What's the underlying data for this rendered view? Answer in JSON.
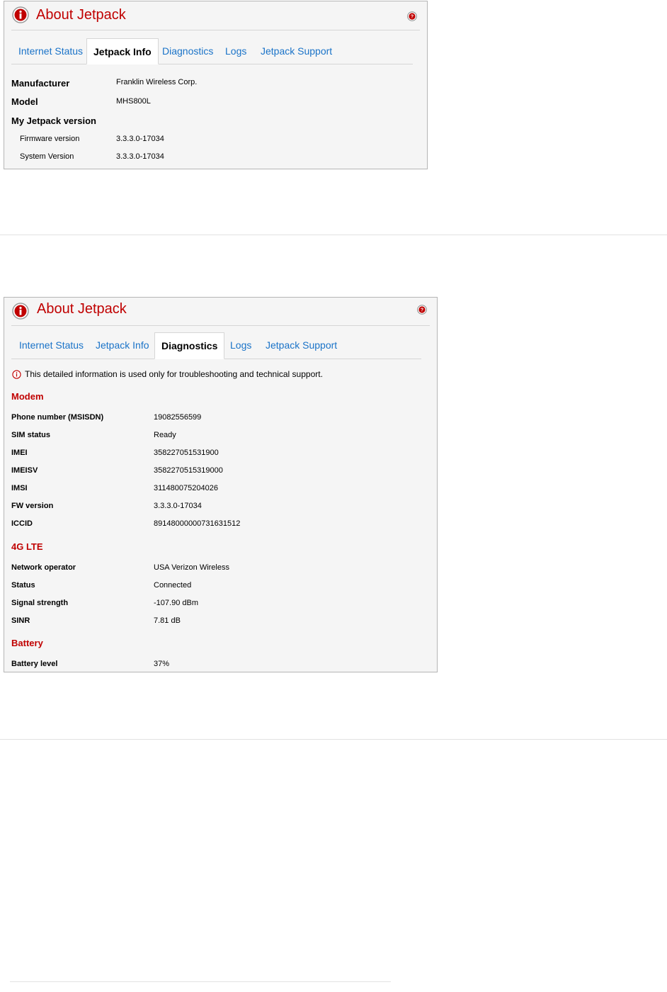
{
  "colors": {
    "title_red": "#c00000",
    "link_blue": "#1a73c8",
    "panel_bg": "#f5f5f5"
  },
  "icons": {
    "info": "info-circle-icon",
    "help": "question-circle-icon"
  },
  "panel1": {
    "title": "About Jetpack",
    "tabs": [
      "Internet Status",
      "Jetpack Info",
      "Diagnostics",
      "Logs",
      "Jetpack Support"
    ],
    "active_tab": "Jetpack Info",
    "manufacturer_label": "Manufacturer",
    "manufacturer_value": "Franklin Wireless Corp.",
    "model_label": "Model",
    "model_value": "MHS800L",
    "version_heading": "My Jetpack version",
    "firmware_label": "Firmware version",
    "firmware_value": "3.3.3.0-17034",
    "system_label": "System Version",
    "system_value": "3.3.3.0-17034"
  },
  "panel2": {
    "title": "About Jetpack",
    "tabs": [
      "Internet Status",
      "Jetpack Info",
      "Diagnostics",
      "Logs",
      "Jetpack Support"
    ],
    "active_tab": "Diagnostics",
    "notice": "This detailed information is used only for troubleshooting and technical support.",
    "modem": {
      "heading": "Modem",
      "rows": [
        {
          "label": "Phone number (MSISDN)",
          "value": "19082556599"
        },
        {
          "label": "SIM status",
          "value": "Ready"
        },
        {
          "label": "IMEI",
          "value": "358227051531900"
        },
        {
          "label": "IMEISV",
          "value": "3582270515319000"
        },
        {
          "label": "IMSI",
          "value": "311480075204026"
        },
        {
          "label": "FW version",
          "value": "3.3.3.0-17034"
        },
        {
          "label": "ICCID",
          "value": "89148000000731631512"
        }
      ]
    },
    "lte": {
      "heading": "4G LTE",
      "rows": [
        {
          "label": "Network operator",
          "value": "USA Verizon Wireless"
        },
        {
          "label": "Status",
          "value": "Connected"
        },
        {
          "label": "Signal strength",
          "value": "-107.90 dBm"
        },
        {
          "label": "SINR",
          "value": "7.81 dB"
        }
      ]
    },
    "battery": {
      "heading": "Battery",
      "rows": [
        {
          "label": "Battery level",
          "value": "37%"
        }
      ]
    }
  }
}
